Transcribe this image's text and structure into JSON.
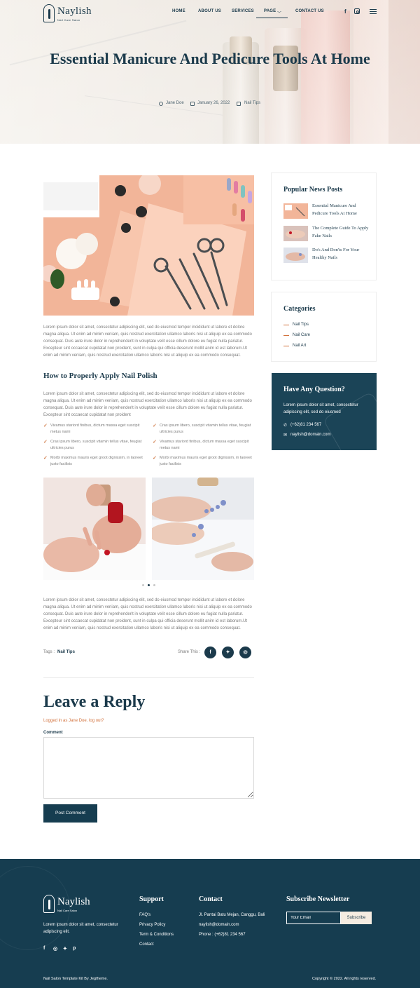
{
  "brand": {
    "name": "Naylish",
    "tagline": "Nail Care Salon"
  },
  "nav": {
    "items": [
      "HOME",
      "ABOUT US",
      "SERVICES",
      "PAGE",
      "CONTACT US"
    ],
    "active": "PAGE",
    "social_icons": [
      "facebook-icon",
      "instagram-icon"
    ],
    "menu_icon": "hamburger-menu-icon"
  },
  "hero": {
    "title": "Essential Manicure And Pedicure Tools At Home",
    "author": "Jane Doe",
    "date": "January 26, 2022",
    "category": "Nail Tips"
  },
  "article": {
    "paragraph1": "Lorem ipsum dolor sit amet, consectetur adipiscing elit, sed do eiusmod tempor incididunt ut labore et dolore magna aliqua. Ut enim ad minim veniam, quis nostrud exercitation ullamco laboris nisi ut aliquip ex ea commodo consequat. Duis aute irure dolor in reprehenderit in voluptate velit esse cillum dolore eu fugiat nulla pariatur. Excepteur sint occaecat cupidatat non proident, sunt in culpa qui officia deserunt mollit anim id est laborum.Ut enim ad minim veniam, quis nostrud exercitation ullamco laboris nisi ut aliquip ex ea commodo consequat.",
    "heading": "How to Properly Apply Nail Polish",
    "paragraph2": "Lorem ipsum dolor sit amet, consectetur adipiscing elit, sed do eiusmod tempor incididunt ut labore et dolore magna aliqua. Ut enim ad minim veniam, quis nostrud exercitation ullamco laboris nisi ut aliquip ex ea commodo consequat. Duis aute irure dolor in reprehenderit in voluptate velit esse cillum dolore eu fugiat nulla pariatur. Excepteur sint occaecat cupidatat non proident",
    "checklist": [
      "Vivamus stariord finibus, dictum massa eget suscipit metus nami",
      "Cras ipsum libero, suscipit vitamin tellus vitae, feugiat ultricies purus",
      "Cras ipsum libero, suscipit vitamin tellus vitae, feugiat ultricies purus",
      "Vivamus stariord finibus, dictum massa eget suscipit metus nami",
      "Morbi maximus mauris eget groot dignissim, in laoreet justo facilisis",
      "Morbi maximus mauris eget groot dignissim, in laoreet justo facilisis"
    ],
    "paragraph3": "Lorem ipsum dolor sit amet, consectetur adipiscing elit, sed do eiusmod tempor incididunt ut labore et dolore magna aliqua. Ut enim ad minim veniam, quis nostrud exercitation ullamco laboris nisi ut aliquip ex ea commodo consequat. Duis aute irure dolor in reprehenderit in voluptate velit esse cillum dolore eu fugiat nulla pariatur. Excepteur sint occaecat cupidatat non proident, sunt in culpa qui officia deserunt mollit anim id est laborum.Ut enim ad minim veniam, quis nostrud exercitation ullamco laboris nisi ut aliquip ex ea commodo consequat.",
    "tags_label": "Tags :",
    "tag": "Nail Tips",
    "share_label": "Share This :",
    "share_icons": [
      "facebook-icon",
      "twitter-icon",
      "whatsapp-icon"
    ]
  },
  "reply": {
    "title": "Leave a Reply",
    "logged_in": "Logged in as Jane Doe. log out?",
    "comment_label": "Comment",
    "comment_value": "",
    "button": "Post Comment"
  },
  "sidebar": {
    "popular_title": "Popular News Posts",
    "posts": [
      "Essential Manicure And Pedicure Tools At Home",
      "The Complete Guide To Apply Fake Nails",
      "Do's And Don'ts For Your Healthy Nails"
    ],
    "categories_title": "Categories",
    "categories": [
      "Nail Tips",
      "Nail Care",
      "Nail Art"
    ],
    "question_title": "Have Any Question?",
    "question_text": "Lorem ipsum dolor sit amet, consectetur adipiscing elit, sed do eiusmod",
    "phone": "(+62)81 234 567",
    "email": "naylish@domain.com"
  },
  "footer": {
    "about": "Lorem ipsum dolor sit amet, consectetur adipiscing elit.",
    "social_icons": [
      "facebook-icon",
      "instagram-icon",
      "twitter-icon",
      "pinterest-icon"
    ],
    "support_title": "Support",
    "support_links": [
      "FAQ's",
      "Privacy Policy",
      "Term & Conditions",
      "Contact"
    ],
    "contact_title": "Contact",
    "address": "Jl. Pantai Batu Mejan, Canggu, Bali",
    "email": "naylish@domain.com",
    "phone": "Phone : (+62)81 234 567",
    "newsletter_title": "Subscribe Newsletter",
    "newsletter_placeholder": "Your Email",
    "newsletter_button": "Subscribe",
    "credit": "Nail Salon Template Kit By Jegtheme.",
    "copyright": "Copyright © 2022. All rights reserved."
  },
  "colors": {
    "primary": "#1b3a4b",
    "footer_bg": "#163d50",
    "accent": "#d2713c"
  }
}
